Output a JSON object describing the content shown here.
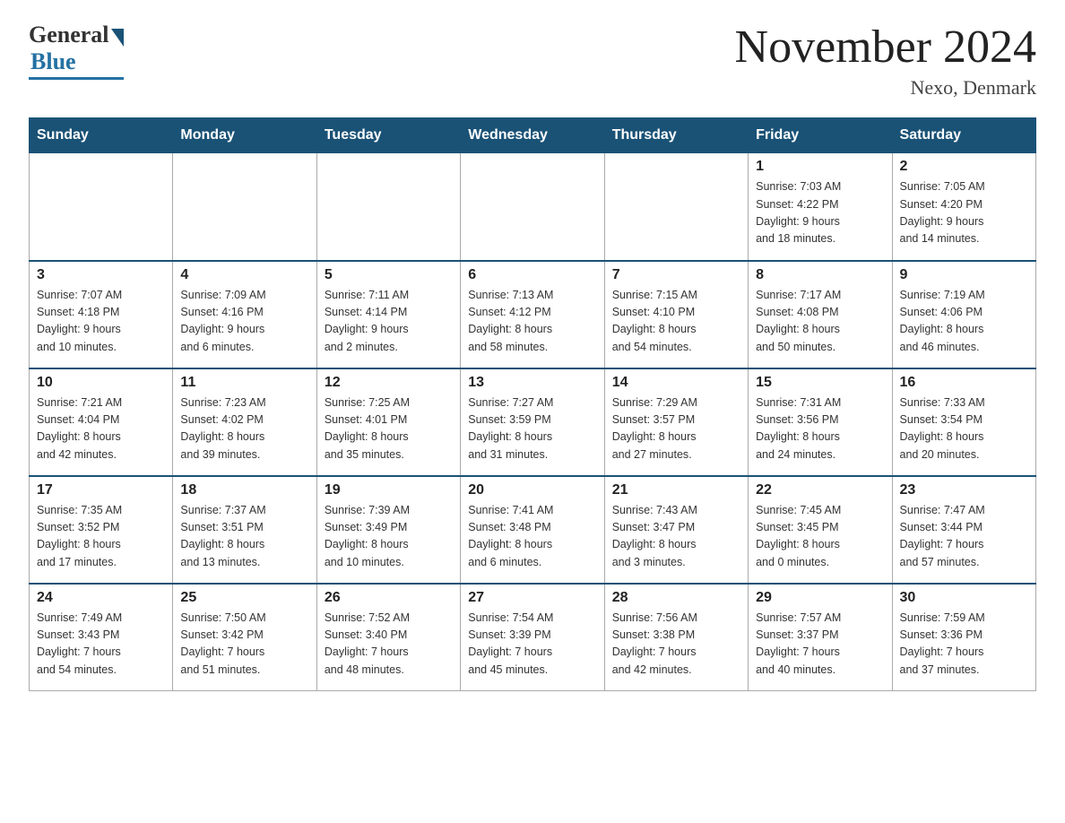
{
  "header": {
    "logo_general": "General",
    "logo_blue": "Blue",
    "month_title": "November 2024",
    "location": "Nexo, Denmark"
  },
  "days_of_week": [
    "Sunday",
    "Monday",
    "Tuesday",
    "Wednesday",
    "Thursday",
    "Friday",
    "Saturday"
  ],
  "weeks": [
    [
      {
        "day": "",
        "info": ""
      },
      {
        "day": "",
        "info": ""
      },
      {
        "day": "",
        "info": ""
      },
      {
        "day": "",
        "info": ""
      },
      {
        "day": "",
        "info": ""
      },
      {
        "day": "1",
        "info": "Sunrise: 7:03 AM\nSunset: 4:22 PM\nDaylight: 9 hours\nand 18 minutes."
      },
      {
        "day": "2",
        "info": "Sunrise: 7:05 AM\nSunset: 4:20 PM\nDaylight: 9 hours\nand 14 minutes."
      }
    ],
    [
      {
        "day": "3",
        "info": "Sunrise: 7:07 AM\nSunset: 4:18 PM\nDaylight: 9 hours\nand 10 minutes."
      },
      {
        "day": "4",
        "info": "Sunrise: 7:09 AM\nSunset: 4:16 PM\nDaylight: 9 hours\nand 6 minutes."
      },
      {
        "day": "5",
        "info": "Sunrise: 7:11 AM\nSunset: 4:14 PM\nDaylight: 9 hours\nand 2 minutes."
      },
      {
        "day": "6",
        "info": "Sunrise: 7:13 AM\nSunset: 4:12 PM\nDaylight: 8 hours\nand 58 minutes."
      },
      {
        "day": "7",
        "info": "Sunrise: 7:15 AM\nSunset: 4:10 PM\nDaylight: 8 hours\nand 54 minutes."
      },
      {
        "day": "8",
        "info": "Sunrise: 7:17 AM\nSunset: 4:08 PM\nDaylight: 8 hours\nand 50 minutes."
      },
      {
        "day": "9",
        "info": "Sunrise: 7:19 AM\nSunset: 4:06 PM\nDaylight: 8 hours\nand 46 minutes."
      }
    ],
    [
      {
        "day": "10",
        "info": "Sunrise: 7:21 AM\nSunset: 4:04 PM\nDaylight: 8 hours\nand 42 minutes."
      },
      {
        "day": "11",
        "info": "Sunrise: 7:23 AM\nSunset: 4:02 PM\nDaylight: 8 hours\nand 39 minutes."
      },
      {
        "day": "12",
        "info": "Sunrise: 7:25 AM\nSunset: 4:01 PM\nDaylight: 8 hours\nand 35 minutes."
      },
      {
        "day": "13",
        "info": "Sunrise: 7:27 AM\nSunset: 3:59 PM\nDaylight: 8 hours\nand 31 minutes."
      },
      {
        "day": "14",
        "info": "Sunrise: 7:29 AM\nSunset: 3:57 PM\nDaylight: 8 hours\nand 27 minutes."
      },
      {
        "day": "15",
        "info": "Sunrise: 7:31 AM\nSunset: 3:56 PM\nDaylight: 8 hours\nand 24 minutes."
      },
      {
        "day": "16",
        "info": "Sunrise: 7:33 AM\nSunset: 3:54 PM\nDaylight: 8 hours\nand 20 minutes."
      }
    ],
    [
      {
        "day": "17",
        "info": "Sunrise: 7:35 AM\nSunset: 3:52 PM\nDaylight: 8 hours\nand 17 minutes."
      },
      {
        "day": "18",
        "info": "Sunrise: 7:37 AM\nSunset: 3:51 PM\nDaylight: 8 hours\nand 13 minutes."
      },
      {
        "day": "19",
        "info": "Sunrise: 7:39 AM\nSunset: 3:49 PM\nDaylight: 8 hours\nand 10 minutes."
      },
      {
        "day": "20",
        "info": "Sunrise: 7:41 AM\nSunset: 3:48 PM\nDaylight: 8 hours\nand 6 minutes."
      },
      {
        "day": "21",
        "info": "Sunrise: 7:43 AM\nSunset: 3:47 PM\nDaylight: 8 hours\nand 3 minutes."
      },
      {
        "day": "22",
        "info": "Sunrise: 7:45 AM\nSunset: 3:45 PM\nDaylight: 8 hours\nand 0 minutes."
      },
      {
        "day": "23",
        "info": "Sunrise: 7:47 AM\nSunset: 3:44 PM\nDaylight: 7 hours\nand 57 minutes."
      }
    ],
    [
      {
        "day": "24",
        "info": "Sunrise: 7:49 AM\nSunset: 3:43 PM\nDaylight: 7 hours\nand 54 minutes."
      },
      {
        "day": "25",
        "info": "Sunrise: 7:50 AM\nSunset: 3:42 PM\nDaylight: 7 hours\nand 51 minutes."
      },
      {
        "day": "26",
        "info": "Sunrise: 7:52 AM\nSunset: 3:40 PM\nDaylight: 7 hours\nand 48 minutes."
      },
      {
        "day": "27",
        "info": "Sunrise: 7:54 AM\nSunset: 3:39 PM\nDaylight: 7 hours\nand 45 minutes."
      },
      {
        "day": "28",
        "info": "Sunrise: 7:56 AM\nSunset: 3:38 PM\nDaylight: 7 hours\nand 42 minutes."
      },
      {
        "day": "29",
        "info": "Sunrise: 7:57 AM\nSunset: 3:37 PM\nDaylight: 7 hours\nand 40 minutes."
      },
      {
        "day": "30",
        "info": "Sunrise: 7:59 AM\nSunset: 3:36 PM\nDaylight: 7 hours\nand 37 minutes."
      }
    ]
  ]
}
